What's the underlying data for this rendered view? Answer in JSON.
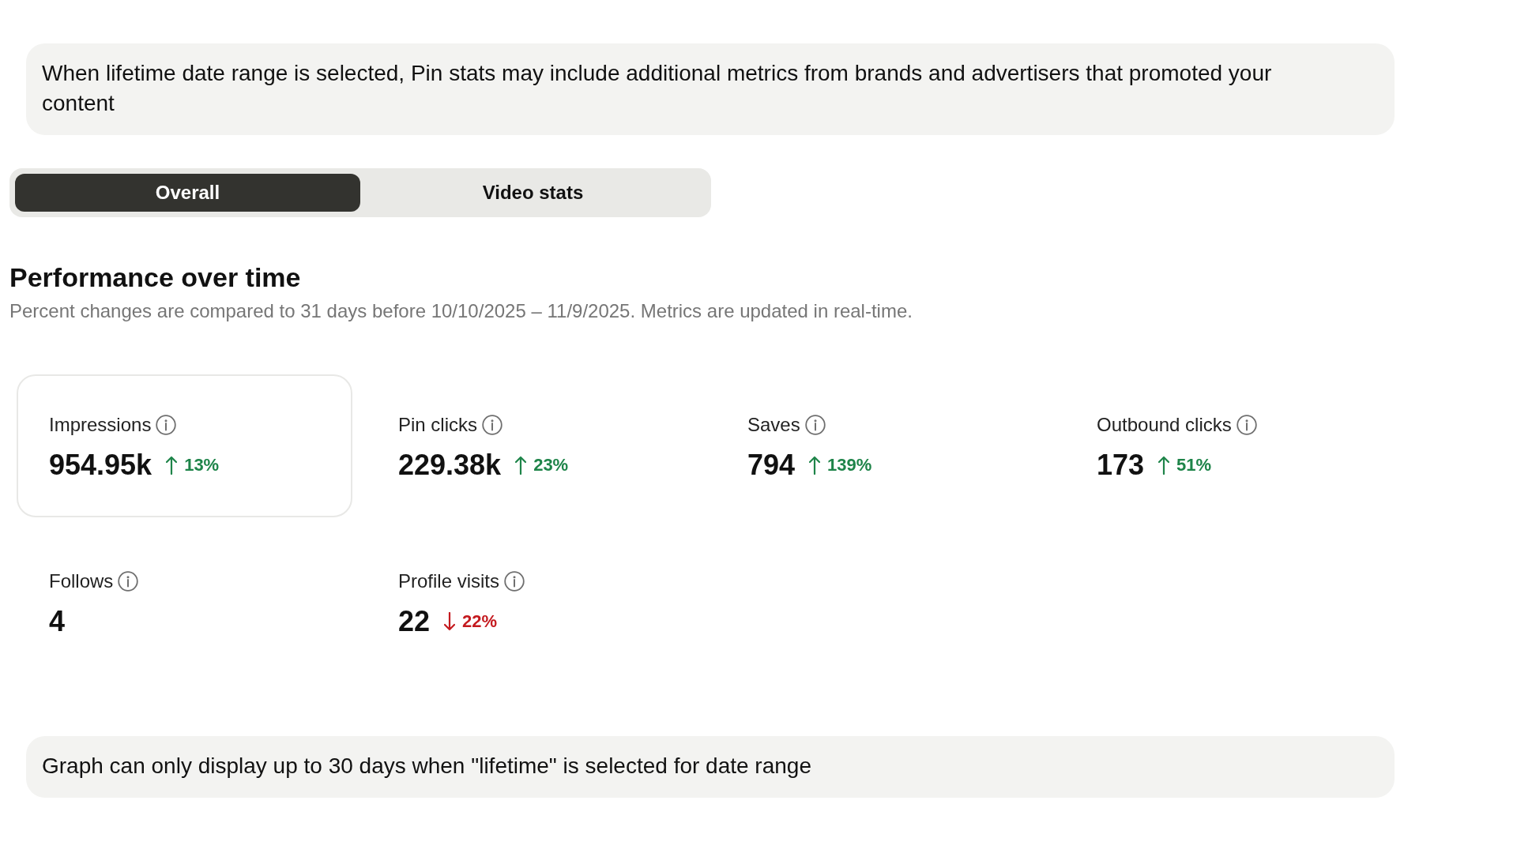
{
  "notice": {
    "text": "When lifetime date range is selected, Pin stats may include additional metrics from brands and advertisers that promoted your content"
  },
  "tabs": [
    {
      "label": "Overall",
      "selected": true
    },
    {
      "label": "Video stats",
      "selected": false
    }
  ],
  "section": {
    "title": "Performance over time",
    "subtitle": "Percent changes are compared to 31 days before 10/10/2025 – 11/9/2025. Metrics are updated in real-time."
  },
  "metrics": [
    {
      "label": "Impressions",
      "value": "954.95k",
      "change": {
        "text": "13%",
        "increase": true
      },
      "selected": true
    },
    {
      "label": "Pin clicks",
      "value": "229.38k",
      "change": {
        "text": "23%",
        "increase": true
      },
      "selected": false
    },
    {
      "label": "Saves",
      "value": "794",
      "change": {
        "text": "139%",
        "increase": true
      },
      "selected": false
    },
    {
      "label": "Outbound clicks",
      "value": "173",
      "change": {
        "text": "51%",
        "increase": true
      },
      "selected": false
    },
    {
      "label": "Follows",
      "value": "4",
      "selected": false
    },
    {
      "label": "Profile visits",
      "value": "22",
      "change": {
        "text": "22%",
        "increase": false
      },
      "selected": false
    }
  ],
  "graph_notice": {
    "text": "Graph can only display up to 30 days when \"lifetime\" is selected for date range"
  }
}
